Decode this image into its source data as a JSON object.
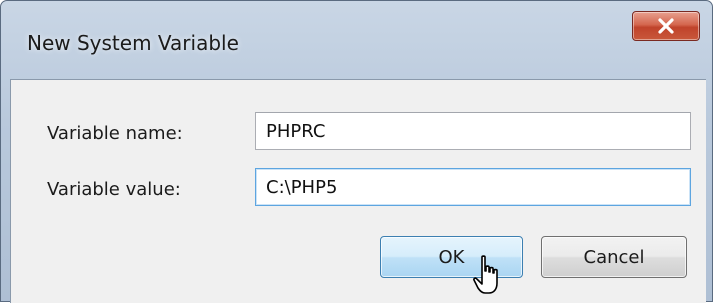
{
  "window": {
    "title": "New System Variable",
    "close_symbol": "x"
  },
  "form": {
    "name_label": "Variable name:",
    "name_value": "PHPRC",
    "value_label": "Variable value:",
    "value_value": "C:\\PHP5"
  },
  "buttons": {
    "ok_label": "OK",
    "cancel_label": "Cancel"
  },
  "icons": {
    "close": "close-icon",
    "cursor": "hand-pointer-icon"
  }
}
